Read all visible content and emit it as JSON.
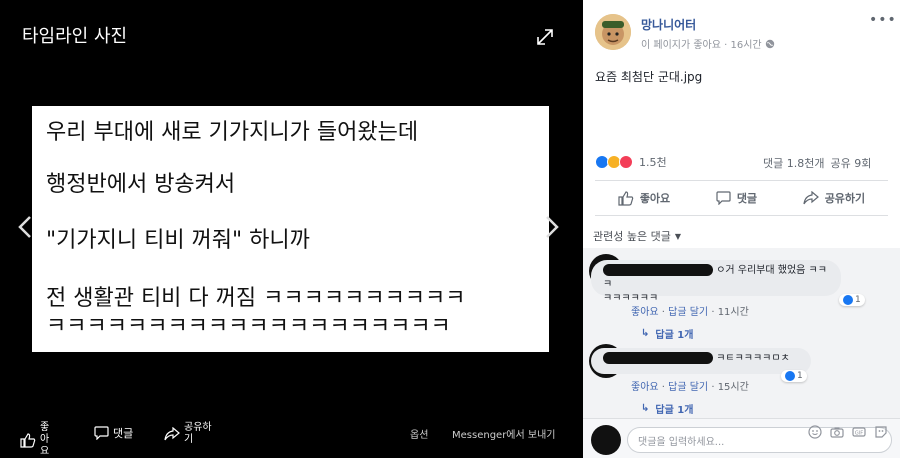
{
  "viewer": {
    "title": "타임라인 사진",
    "photo_lines": [
      "우리 부대에 새로 기가지니가 들어왔는데",
      "행정반에서 방송켜서",
      "\"기가지니 티비 꺼줘\" 하니까",
      "전 생활관 티비 다 꺼짐 ㅋㅋㅋㅋㅋㅋㅋㅋㅋㅋ",
      "ㅋㅋㅋㅋㅋㅋㅋㅋㅋㅋㅋㅋㅋㅋㅋㅋㅋㅋㅋㅋ"
    ],
    "like_label": "좋아요",
    "comment_label": "댓글",
    "share_label": "공유하기",
    "options_label": "옵션",
    "messenger_label": "Messenger에서 보내기"
  },
  "post": {
    "page_name": "망나니어터",
    "meta": "이 페이지가 좋아요 · 16시간",
    "text": "요즘 최첨단 군대.jpg",
    "reaction_count": "1.5천",
    "comment_count": "댓글 1.8천개",
    "share_count": "공유 9회",
    "actions": {
      "like": "좋아요",
      "comment": "댓글",
      "share": "공유하기"
    },
    "sort_label": "관련성 높은 댓글",
    "comments": [
      {
        "text_visible": "ㅇ거 우리부대 했었음 ㅋㅋㅋ",
        "text_line2": "ㅋㅋㅋㅋㅋㅋ",
        "like": "좋아요",
        "reply": "답글 달기",
        "time": "11시간",
        "reaction_count": "1",
        "replies": "답글 1개"
      },
      {
        "text_visible": "ㅋㅌㅋㅋㅋㅋㅁㅊ",
        "like": "좋아요",
        "reply": "답글 달기",
        "time": "15시간",
        "reaction_count": "1",
        "replies": "답글 1개"
      }
    ],
    "write_placeholder": "댓글을 입력하세요..."
  },
  "colors": {
    "link_blue": "#365899",
    "reply_blue": "#4267b2",
    "like_blue": "#1877f2",
    "love_red": "#f33e58",
    "haha_yellow": "#f7b125"
  }
}
